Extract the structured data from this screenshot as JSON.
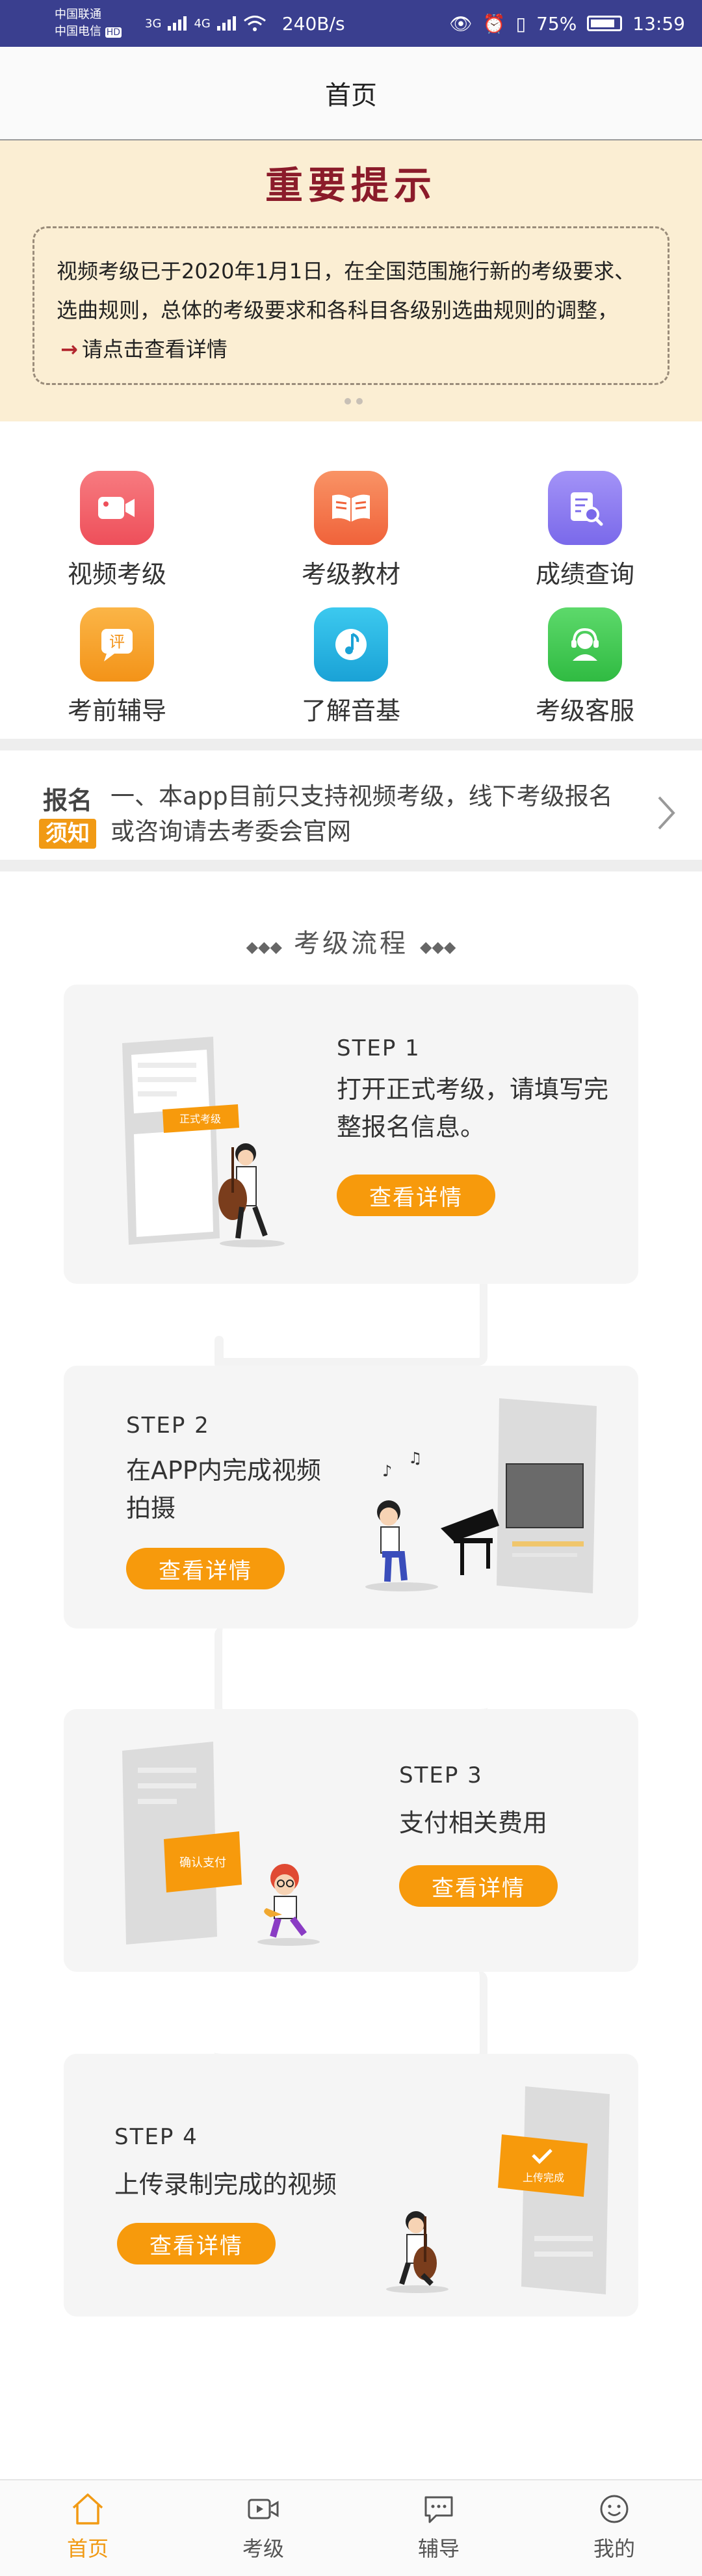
{
  "status_bar": {
    "carrier1": "中国联通",
    "carrier2": "中国电信",
    "hd": "HD",
    "net1": "3G",
    "net2": "4G",
    "speed": "240B/s",
    "battery": "75%",
    "time": "13:59"
  },
  "nav": {
    "title": "首页"
  },
  "notice": {
    "title": "重要提示",
    "body": "视频考级已于2020年1月1日，在全国范围施行新的考级要求、选曲规则，总体的考级要求和各科目各级别选曲规则的调整，",
    "link": "请点击查看详情"
  },
  "grid": [
    {
      "label": "视频考级",
      "icon": "video-camera-icon",
      "color": "#f2646c"
    },
    {
      "label": "考级教材",
      "icon": "book-icon",
      "color": "#f5784a"
    },
    {
      "label": "成绩查询",
      "icon": "search-document-icon",
      "color": "#8a7bf0"
    },
    {
      "label": "考前辅导",
      "icon": "comment-review-icon",
      "color": "#f7a12a"
    },
    {
      "label": "了解音基",
      "icon": "music-note-icon",
      "color": "#25b6e3"
    },
    {
      "label": "考级客服",
      "icon": "customer-service-icon",
      "color": "#3fcb4f"
    }
  ],
  "registration": {
    "tag1": "报名",
    "tag2": "须知",
    "text": "一、本app目前只支持视频考级，线下考级报名或咨询请去考委会官网"
  },
  "flow": {
    "title": "考级流程",
    "steps": [
      {
        "label": "STEP 1",
        "desc": "打开正式考级，请填写完整报名信息。",
        "button": "查看详情",
        "badge": "正式考级"
      },
      {
        "label": "STEP 2",
        "desc": "在APP内完成视频拍摄",
        "button": "查看详情"
      },
      {
        "label": "STEP 3",
        "desc": "支付相关费用",
        "button": "查看详情",
        "badge": "确认支付"
      },
      {
        "label": "STEP 4",
        "desc": "上传录制完成的视频",
        "button": "查看详情",
        "badge": "上传完成"
      }
    ]
  },
  "tabs": [
    {
      "label": "首页",
      "icon": "home-icon",
      "active": true
    },
    {
      "label": "考级",
      "icon": "video-icon"
    },
    {
      "label": "辅导",
      "icon": "chat-icon"
    },
    {
      "label": "我的",
      "icon": "smiley-icon"
    }
  ],
  "colors": {
    "accent": "#f79a0c",
    "notice_bg": "#fbeed3",
    "notice_title": "#8b1b2a",
    "status_bar": "#3a3f8f"
  }
}
